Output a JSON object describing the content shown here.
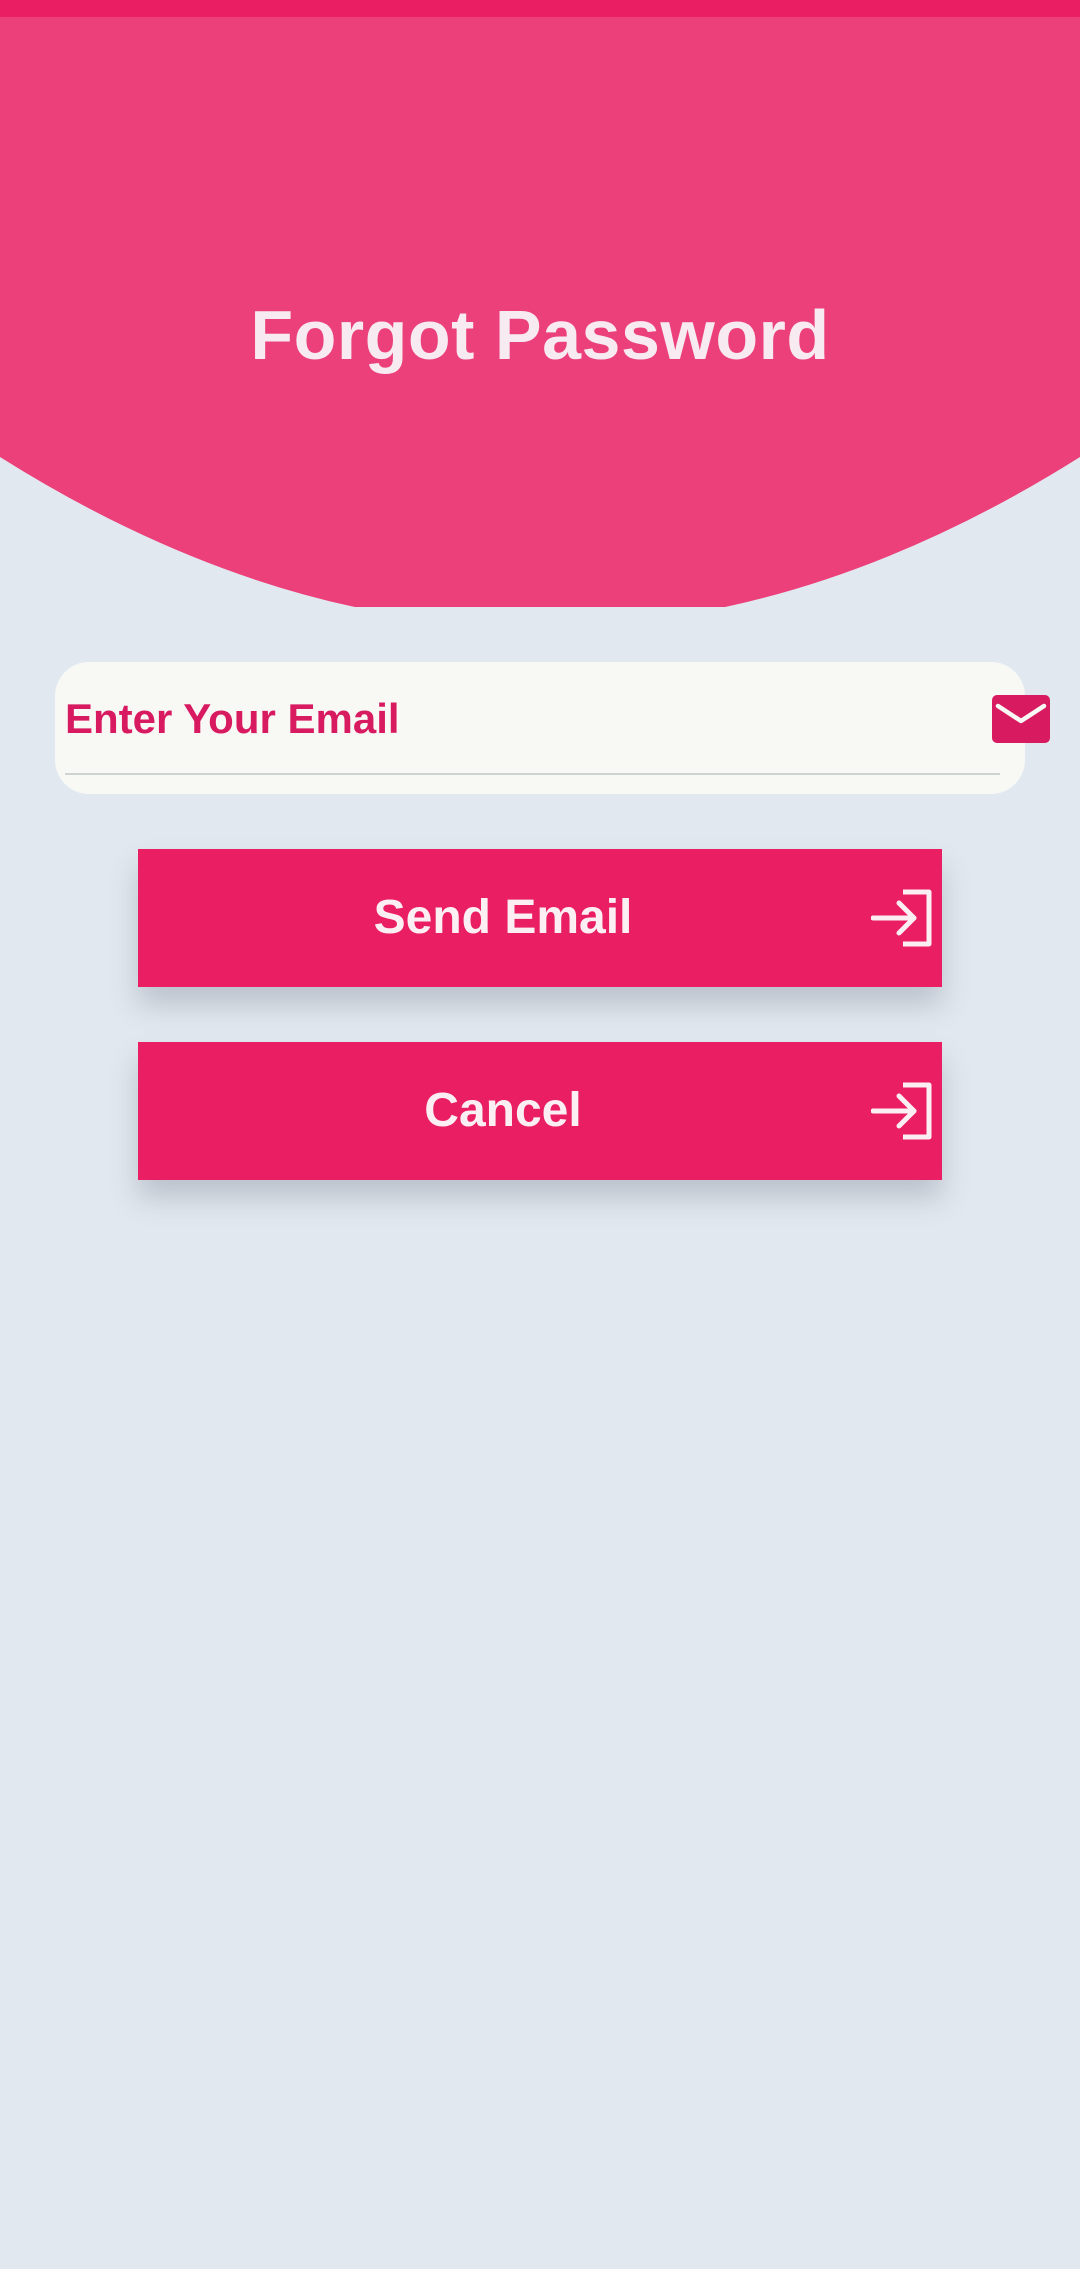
{
  "header": {
    "title": "Forgot Password",
    "background_color": "#ec407a",
    "strip_color": "#e91e63"
  },
  "email_field": {
    "placeholder": "Enter Your Email",
    "value": "",
    "icon": "mail-icon"
  },
  "buttons": {
    "send": {
      "label": "Send Email",
      "icon": "login-arrow-icon",
      "color": "#e91e63"
    },
    "cancel": {
      "label": "Cancel",
      "icon": "login-arrow-icon",
      "color": "#e91e63"
    }
  },
  "theme": {
    "page_background": "#e2e8ef",
    "accent": "#d81b60"
  }
}
